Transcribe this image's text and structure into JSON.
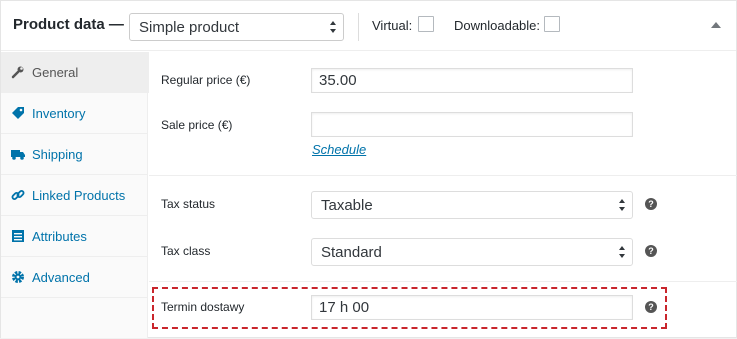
{
  "header": {
    "title": "Product data —",
    "product_type": "Simple product",
    "virtual_label": "Virtual:",
    "downloadable_label": "Downloadable:"
  },
  "sidebar": {
    "items": [
      {
        "label": "General",
        "icon": "wrench-icon",
        "active": true
      },
      {
        "label": "Inventory",
        "icon": "tag-icon"
      },
      {
        "label": "Shipping",
        "icon": "truck-icon"
      },
      {
        "label": "Linked Products",
        "icon": "link-icon"
      },
      {
        "label": "Attributes",
        "icon": "list-icon"
      },
      {
        "label": "Advanced",
        "icon": "gear-icon"
      }
    ]
  },
  "general": {
    "regular_price_label": "Regular price (€)",
    "regular_price_value": "35.00",
    "sale_price_label": "Sale price (€)",
    "sale_price_value": "",
    "schedule_link": "Schedule",
    "tax_status_label": "Tax status",
    "tax_status_value": "Taxable",
    "tax_class_label": "Tax class",
    "tax_class_value": "Standard",
    "delivery_label": "Termin dostawy",
    "delivery_value": "17 h 00",
    "help_glyph": "?"
  },
  "colors": {
    "link": "#0073aa",
    "highlight": "#c9252c"
  }
}
